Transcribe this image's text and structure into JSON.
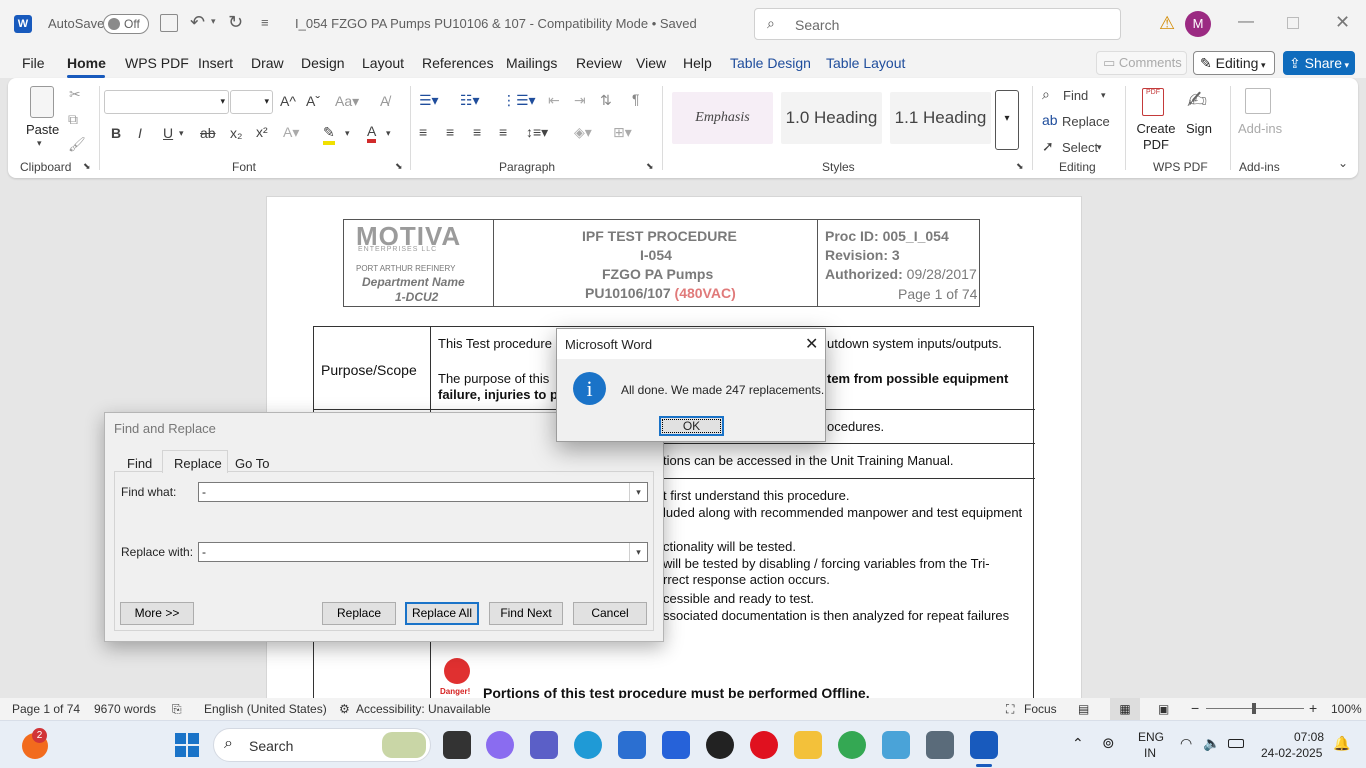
{
  "titlebar": {
    "autosave_label": "AutoSave",
    "autosave_state": "Off",
    "document_title": "I_054 FZGO PA Pumps PU10106 & 107  -  Compatibility Mode  •  Saved",
    "search_placeholder": "Search",
    "avatar_letter": "M"
  },
  "menu": {
    "items": [
      "File",
      "Home",
      "WPS PDF",
      "Insert",
      "Draw",
      "Design",
      "Layout",
      "References",
      "Mailings",
      "Review",
      "View",
      "Help"
    ],
    "context_tabs": [
      "Table Design",
      "Table Layout"
    ],
    "comments_label": "Comments",
    "editing_label": "Editing",
    "share_label": "Share"
  },
  "ribbon": {
    "clipboard": {
      "paste_label": "Paste",
      "group_label": "Clipboard"
    },
    "font": {
      "group_label": "Font",
      "bold": "B",
      "italic": "I",
      "underline": "U",
      "strikethrough": "ab"
    },
    "paragraph": {
      "group_label": "Paragraph"
    },
    "styles": {
      "group_label": "Styles",
      "cards": [
        "Emphasis",
        "1.0  Heading",
        "1.1  Heading"
      ]
    },
    "editing": {
      "group_label": "Editing",
      "find_label": "Find",
      "replace_label": "Replace",
      "select_label": "Select"
    },
    "wps_pdf": {
      "group_label": "WPS PDF",
      "create_pdf_label": "Create PDF",
      "sign_label": "Sign"
    },
    "addins": {
      "group_label": "Add-ins",
      "addins_label": "Add-ins"
    }
  },
  "document": {
    "header": {
      "logo_text": "MOTIVA",
      "logo_sub": "ENTERPRISES LLC",
      "refinery": "PORT ARTHUR REFINERY",
      "dept_line1": "Department Name",
      "dept_line2": "1-DCU2",
      "title_line1": "IPF TEST PROCEDURE",
      "title_line2": "I-054",
      "title_line3": "FZGO PA Pumps",
      "title_line4_a": "PU10106/107 ",
      "title_line4_b": "(480VAC)",
      "proc_id": "Proc ID: 005_I_054",
      "revision": "Revision: 3",
      "authorized_label": "Authorized:",
      "authorized_date": "09/28/2017",
      "page_of": "Page 1 of 74"
    },
    "body": {
      "purpose_label": "Purpose/Scope",
      "line1_a": "This Test procedure",
      "line1_b": "utdown system inputs/outputs.",
      "line2_a": "The purpose of this",
      "line2_b": "tem from possible equipment",
      "line3": "failure, injuries to p",
      "line4": "ocedures.",
      "line5": "tions can be accessed in the Unit Training Manual.",
      "line6": "t first understand this procedure.",
      "line7": "luded along with recommended manpower and test equipment",
      "line8": "ctionality will be tested.",
      "line9": "will be tested by disabling / forcing variables from the Tri-",
      "line10": "rrect response action occurs.",
      "line11": "cessible and ready to test.",
      "line12": "ssociated documentation is then analyzed for repeat failures",
      "danger_label": "Danger!",
      "offline_notice": "Portions of this test procedure must be performed Offline."
    }
  },
  "find_replace": {
    "title": "Find and Replace",
    "tabs": [
      "Find",
      "Replace",
      "Go To"
    ],
    "active_tab": "Replace",
    "find_label": "Find what:",
    "find_value": "-",
    "replace_label": "Replace with:",
    "replace_value": "-",
    "more_button": "More >>",
    "replace_button": "Replace",
    "replace_all_button": "Replace All",
    "find_next_button": "Find Next",
    "cancel_button": "Cancel"
  },
  "message_box": {
    "title": "Microsoft Word",
    "message": "All done. We made 247 replacements.",
    "ok_button": "OK"
  },
  "statusbar": {
    "page": "Page 1 of 74",
    "words": "9670 words",
    "language": "English (United States)",
    "accessibility": "Accessibility: Unavailable",
    "focus": "Focus",
    "zoom": "100%"
  },
  "taskbar": {
    "search_label": "Search",
    "notification_count": "2",
    "lang_line1": "ENG",
    "lang_line2": "IN",
    "time": "07:08",
    "date": "24-02-2025"
  },
  "colors": {
    "accent": "#185abd",
    "share_bg": "#0f6cbd",
    "avatar_bg": "#9b2a82",
    "danger_red": "#e03030",
    "info_blue": "#1a73c8"
  }
}
